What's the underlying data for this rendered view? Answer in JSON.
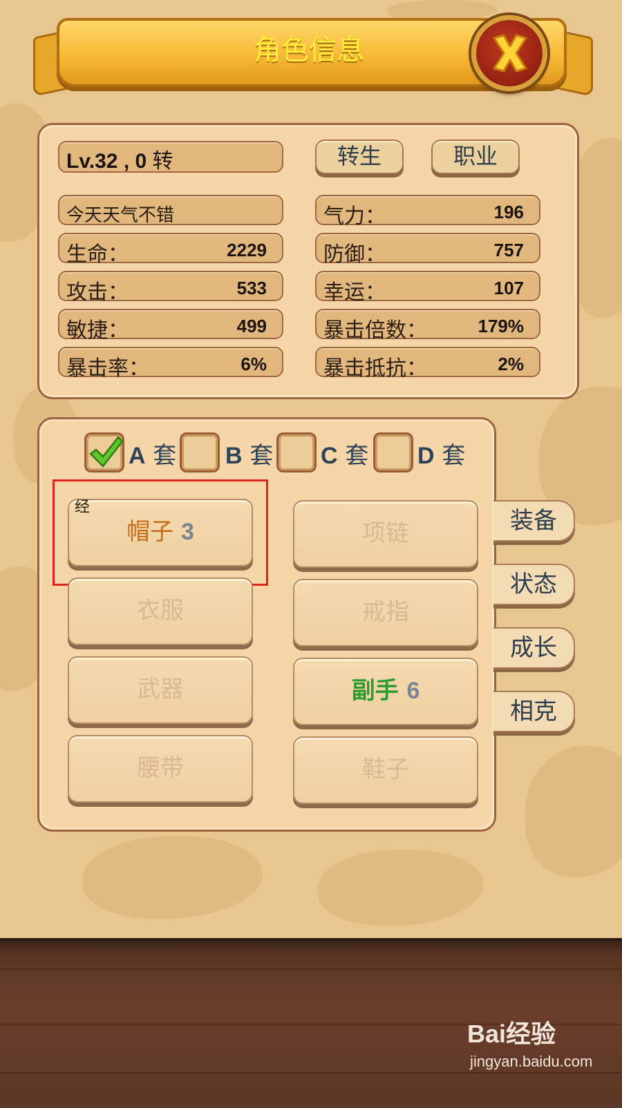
{
  "header": {
    "title": "角色信息"
  },
  "level": {
    "prefix": "Lv.32 , 0",
    "suffix": "转"
  },
  "buttons": {
    "rebirth": "转生",
    "job": "职业"
  },
  "stats_left": [
    {
      "label": "今天天气不错",
      "value": ""
    },
    {
      "label": "生命：",
      "value": "2229"
    },
    {
      "label": "攻击：",
      "value": "533"
    },
    {
      "label": "敏捷：",
      "value": "499"
    },
    {
      "label": "暴击率：",
      "value": "6%"
    }
  ],
  "stats_right": [
    {
      "label": "气力：",
      "value": "196"
    },
    {
      "label": "防御：",
      "value": "757"
    },
    {
      "label": "幸运：",
      "value": "107"
    },
    {
      "label": "暴击倍数：",
      "value": "179%"
    },
    {
      "label": "暴击抵抗：",
      "value": "2%"
    }
  ],
  "sets": [
    {
      "letter": "A",
      "suffix": "套",
      "checked": true
    },
    {
      "letter": "B",
      "suffix": "套",
      "checked": false
    },
    {
      "letter": "C",
      "suffix": "套",
      "checked": false
    },
    {
      "letter": "D",
      "suffix": "套",
      "checked": false
    }
  ],
  "equipment": {
    "tag": "经",
    "hat": {
      "label": "帽子",
      "level": "3"
    },
    "necklace": "项链",
    "clothes": "衣服",
    "ring": "戒指",
    "weapon": "武器",
    "offhand": {
      "label": "副手",
      "level": "6"
    },
    "belt": "腰带",
    "shoes": "鞋子"
  },
  "side_tabs": [
    "装备",
    "状态",
    "成长",
    "相克"
  ],
  "watermark": {
    "brand": "Bai经验",
    "url": "jingyan.baidu.com"
  },
  "colors": {
    "accent_gold": "#f6b935",
    "title_yellow": "#ffee3a",
    "highlight_red": "#e0231c",
    "offhand_green": "#2d9b2e"
  }
}
